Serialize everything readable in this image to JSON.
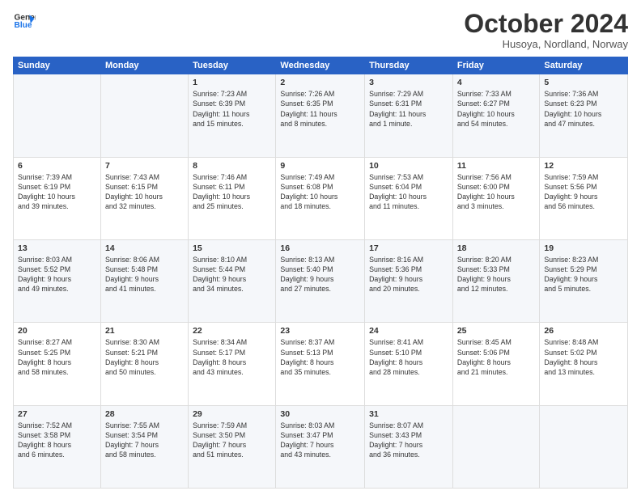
{
  "header": {
    "logo_line1": "General",
    "logo_line2": "Blue",
    "month": "October 2024",
    "location": "Husoya, Nordland, Norway"
  },
  "weekdays": [
    "Sunday",
    "Monday",
    "Tuesday",
    "Wednesday",
    "Thursday",
    "Friday",
    "Saturday"
  ],
  "weeks": [
    [
      {
        "day": "",
        "text": ""
      },
      {
        "day": "",
        "text": ""
      },
      {
        "day": "1",
        "text": "Sunrise: 7:23 AM\nSunset: 6:39 PM\nDaylight: 11 hours\nand 15 minutes."
      },
      {
        "day": "2",
        "text": "Sunrise: 7:26 AM\nSunset: 6:35 PM\nDaylight: 11 hours\nand 8 minutes."
      },
      {
        "day": "3",
        "text": "Sunrise: 7:29 AM\nSunset: 6:31 PM\nDaylight: 11 hours\nand 1 minute."
      },
      {
        "day": "4",
        "text": "Sunrise: 7:33 AM\nSunset: 6:27 PM\nDaylight: 10 hours\nand 54 minutes."
      },
      {
        "day": "5",
        "text": "Sunrise: 7:36 AM\nSunset: 6:23 PM\nDaylight: 10 hours\nand 47 minutes."
      }
    ],
    [
      {
        "day": "6",
        "text": "Sunrise: 7:39 AM\nSunset: 6:19 PM\nDaylight: 10 hours\nand 39 minutes."
      },
      {
        "day": "7",
        "text": "Sunrise: 7:43 AM\nSunset: 6:15 PM\nDaylight: 10 hours\nand 32 minutes."
      },
      {
        "day": "8",
        "text": "Sunrise: 7:46 AM\nSunset: 6:11 PM\nDaylight: 10 hours\nand 25 minutes."
      },
      {
        "day": "9",
        "text": "Sunrise: 7:49 AM\nSunset: 6:08 PM\nDaylight: 10 hours\nand 18 minutes."
      },
      {
        "day": "10",
        "text": "Sunrise: 7:53 AM\nSunset: 6:04 PM\nDaylight: 10 hours\nand 11 minutes."
      },
      {
        "day": "11",
        "text": "Sunrise: 7:56 AM\nSunset: 6:00 PM\nDaylight: 10 hours\nand 3 minutes."
      },
      {
        "day": "12",
        "text": "Sunrise: 7:59 AM\nSunset: 5:56 PM\nDaylight: 9 hours\nand 56 minutes."
      }
    ],
    [
      {
        "day": "13",
        "text": "Sunrise: 8:03 AM\nSunset: 5:52 PM\nDaylight: 9 hours\nand 49 minutes."
      },
      {
        "day": "14",
        "text": "Sunrise: 8:06 AM\nSunset: 5:48 PM\nDaylight: 9 hours\nand 41 minutes."
      },
      {
        "day": "15",
        "text": "Sunrise: 8:10 AM\nSunset: 5:44 PM\nDaylight: 9 hours\nand 34 minutes."
      },
      {
        "day": "16",
        "text": "Sunrise: 8:13 AM\nSunset: 5:40 PM\nDaylight: 9 hours\nand 27 minutes."
      },
      {
        "day": "17",
        "text": "Sunrise: 8:16 AM\nSunset: 5:36 PM\nDaylight: 9 hours\nand 20 minutes."
      },
      {
        "day": "18",
        "text": "Sunrise: 8:20 AM\nSunset: 5:33 PM\nDaylight: 9 hours\nand 12 minutes."
      },
      {
        "day": "19",
        "text": "Sunrise: 8:23 AM\nSunset: 5:29 PM\nDaylight: 9 hours\nand 5 minutes."
      }
    ],
    [
      {
        "day": "20",
        "text": "Sunrise: 8:27 AM\nSunset: 5:25 PM\nDaylight: 8 hours\nand 58 minutes."
      },
      {
        "day": "21",
        "text": "Sunrise: 8:30 AM\nSunset: 5:21 PM\nDaylight: 8 hours\nand 50 minutes."
      },
      {
        "day": "22",
        "text": "Sunrise: 8:34 AM\nSunset: 5:17 PM\nDaylight: 8 hours\nand 43 minutes."
      },
      {
        "day": "23",
        "text": "Sunrise: 8:37 AM\nSunset: 5:13 PM\nDaylight: 8 hours\nand 35 minutes."
      },
      {
        "day": "24",
        "text": "Sunrise: 8:41 AM\nSunset: 5:10 PM\nDaylight: 8 hours\nand 28 minutes."
      },
      {
        "day": "25",
        "text": "Sunrise: 8:45 AM\nSunset: 5:06 PM\nDaylight: 8 hours\nand 21 minutes."
      },
      {
        "day": "26",
        "text": "Sunrise: 8:48 AM\nSunset: 5:02 PM\nDaylight: 8 hours\nand 13 minutes."
      }
    ],
    [
      {
        "day": "27",
        "text": "Sunrise: 7:52 AM\nSunset: 3:58 PM\nDaylight: 8 hours\nand 6 minutes."
      },
      {
        "day": "28",
        "text": "Sunrise: 7:55 AM\nSunset: 3:54 PM\nDaylight: 7 hours\nand 58 minutes."
      },
      {
        "day": "29",
        "text": "Sunrise: 7:59 AM\nSunset: 3:50 PM\nDaylight: 7 hours\nand 51 minutes."
      },
      {
        "day": "30",
        "text": "Sunrise: 8:03 AM\nSunset: 3:47 PM\nDaylight: 7 hours\nand 43 minutes."
      },
      {
        "day": "31",
        "text": "Sunrise: 8:07 AM\nSunset: 3:43 PM\nDaylight: 7 hours\nand 36 minutes."
      },
      {
        "day": "",
        "text": ""
      },
      {
        "day": "",
        "text": ""
      }
    ]
  ]
}
